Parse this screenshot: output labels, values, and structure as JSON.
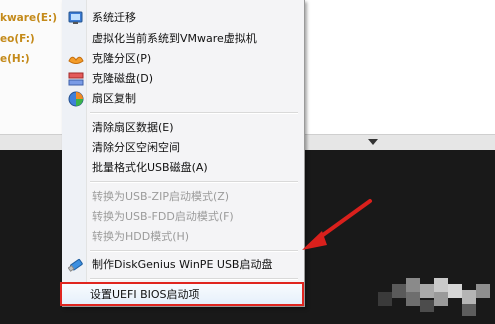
{
  "drive_tree": {
    "items": [
      {
        "label": "kware(E:)"
      },
      {
        "label": "eo(F:)"
      },
      {
        "label": "e(H:)"
      }
    ]
  },
  "context_menu": {
    "items": [
      {
        "label": "系统迁移",
        "icon": "migrate-icon"
      },
      {
        "label": "虚拟化当前系统到VMware虚拟机",
        "icon": ""
      },
      {
        "label": "克隆分区(P)",
        "icon": "clone-partition-icon"
      },
      {
        "label": "克隆磁盘(D)",
        "icon": "clone-disk-icon"
      },
      {
        "label": "扇区复制",
        "icon": "sector-copy-icon"
      },
      {
        "label": "清除扇区数据(E)",
        "icon": ""
      },
      {
        "label": "清除分区空闲空间",
        "icon": ""
      },
      {
        "label": "批量格式化USB磁盘(A)",
        "icon": ""
      },
      {
        "label": "转换为USB-ZIP启动模式(Z)",
        "icon": ""
      },
      {
        "label": "转换为USB-FDD启动模式(F)",
        "icon": ""
      },
      {
        "label": "转换为HDD模式(H)",
        "icon": ""
      },
      {
        "label": "制作DiskGenius WinPE USB启动盘",
        "icon": "usb-drive-icon"
      },
      {
        "label": "设置UEFI BIOS启动项",
        "icon": ""
      }
    ]
  },
  "colors": {
    "highlight_border": "#e0251f",
    "arrow": "#d9201c",
    "drive_label": "#c48a1a"
  }
}
